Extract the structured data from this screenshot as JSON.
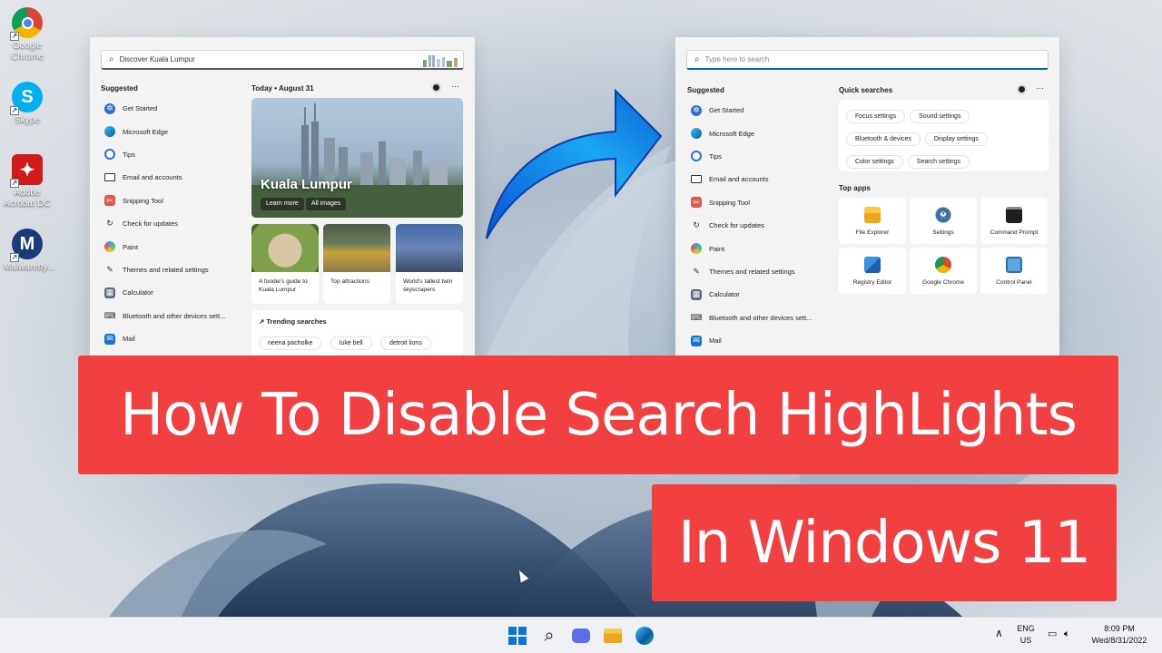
{
  "desktop": {
    "icons": [
      {
        "label": "Google Chrome",
        "icon": "chrome-icon"
      },
      {
        "label": "Skype",
        "icon": "skype-icon"
      },
      {
        "label": "Adobe Acrobat DC",
        "icon": "acrobat-icon"
      },
      {
        "label": "Malwareby...",
        "icon": "malwarebytes-icon"
      }
    ]
  },
  "left_panel": {
    "search_text": "Discover Kuala Lumpur",
    "suggested_title": "Suggested",
    "suggested": [
      {
        "label": "Get Started"
      },
      {
        "label": "Microsoft Edge"
      },
      {
        "label": "Tips"
      },
      {
        "label": "Email and accounts"
      },
      {
        "label": "Snipping Tool"
      },
      {
        "label": "Check for updates"
      },
      {
        "label": "Paint"
      },
      {
        "label": "Themes and related settings"
      },
      {
        "label": "Calculator"
      },
      {
        "label": "Bluetooth and other devices sett..."
      },
      {
        "label": "Mail"
      }
    ],
    "today_label": "Today",
    "date": "August 31",
    "more": "···",
    "hero": {
      "title": "Kuala Lumpur",
      "learn_more": "Learn more",
      "all_images": "All images"
    },
    "cards": [
      {
        "caption": "A foodie's guide to Kuala Lumpur"
      },
      {
        "caption": "Top attractions"
      },
      {
        "caption": "World's tallest twin skyscrapers"
      }
    ],
    "trending_title": "Trending searches",
    "trending": [
      "neena pacholke",
      "luke bell",
      "detroit lions"
    ]
  },
  "right_panel": {
    "search_placeholder": "Type here to search",
    "suggested_title": "Suggested",
    "suggested": [
      {
        "label": "Get Started"
      },
      {
        "label": "Microsoft Edge"
      },
      {
        "label": "Tips"
      },
      {
        "label": "Email and accounts"
      },
      {
        "label": "Snipping Tool"
      },
      {
        "label": "Check for updates"
      },
      {
        "label": "Paint"
      },
      {
        "label": "Themes and related settings"
      },
      {
        "label": "Calculator"
      },
      {
        "label": "Bluetooth and other devices sett..."
      },
      {
        "label": "Mail"
      }
    ],
    "quick_searches_title": "Quick searches",
    "more": "···",
    "quick_searches": [
      [
        "Focus settings",
        "Sound settings"
      ],
      [
        "Bluetooth & devices",
        "Display settings"
      ],
      [
        "Color settings",
        "Search settings"
      ]
    ],
    "top_apps_title": "Top apps",
    "top_apps": [
      {
        "label": "File Explorer"
      },
      {
        "label": "Settings"
      },
      {
        "label": "Command Prompt"
      },
      {
        "label": "Registry Editor"
      },
      {
        "label": "Google Chrome"
      },
      {
        "label": "Control Panel"
      }
    ]
  },
  "banner": {
    "line1": "How To Disable Search HighLights",
    "line2": "In Windows 11"
  },
  "taskbar": {
    "lang": "ENG",
    "region": "US",
    "time": "8:09 PM",
    "date": "Wed/8/31/2022",
    "chevron": "∧"
  },
  "colors": {
    "banner_bg": "#f24040",
    "accent": "#0067c0"
  }
}
